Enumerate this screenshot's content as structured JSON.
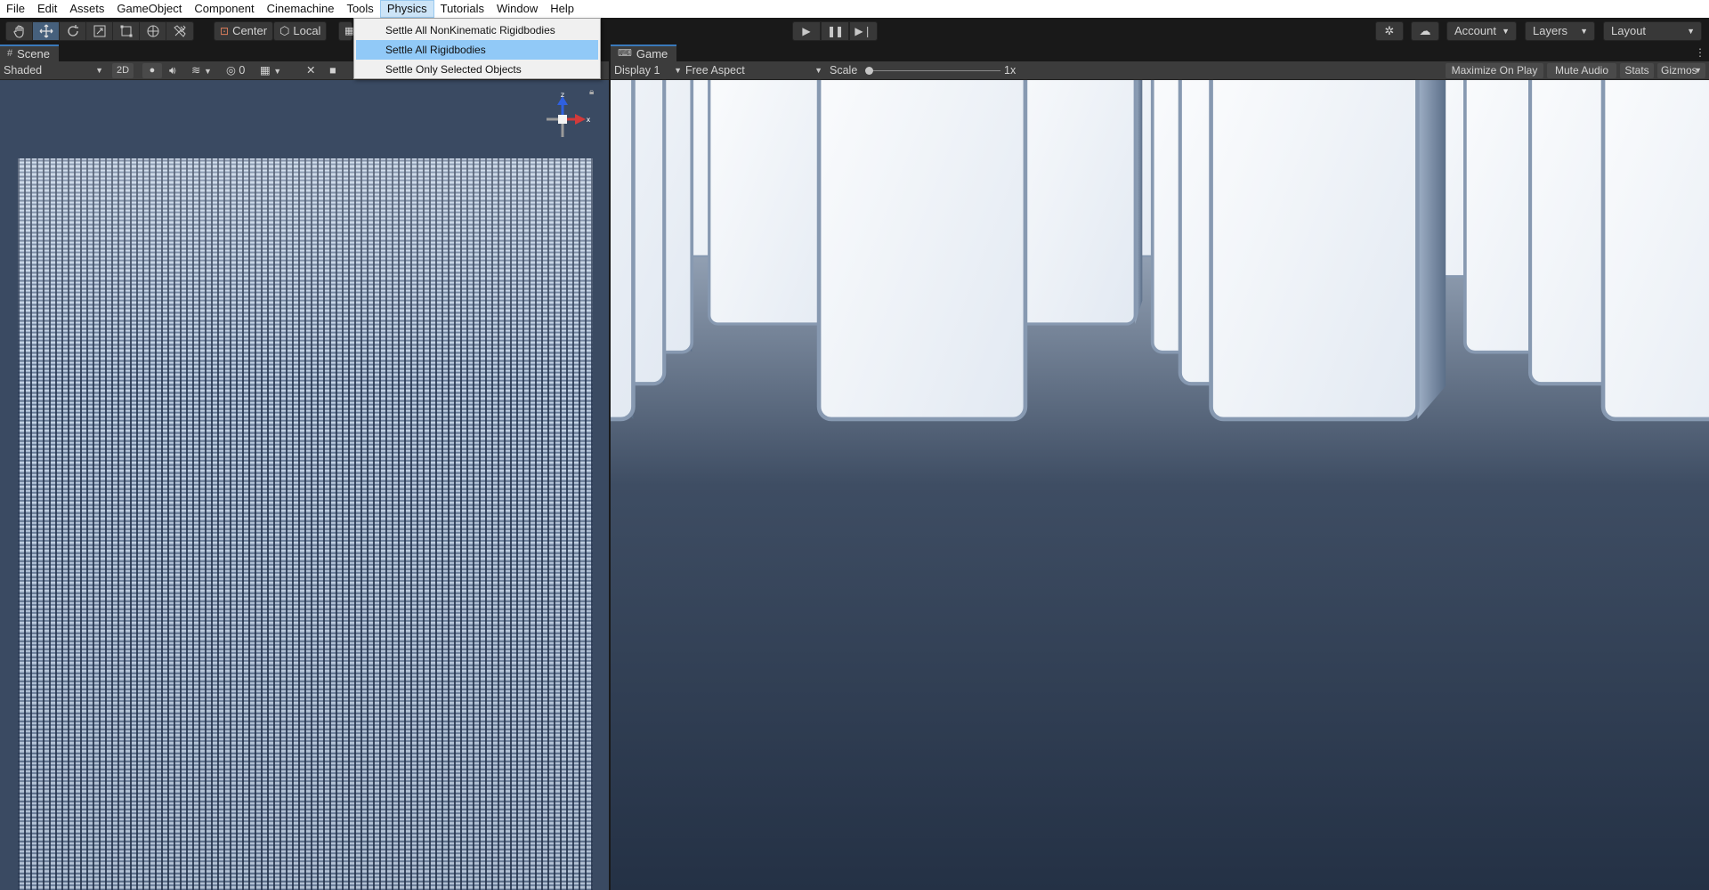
{
  "menubar": {
    "items": [
      "File",
      "Edit",
      "Assets",
      "GameObject",
      "Component",
      "Cinemachine",
      "Tools",
      "Physics",
      "Tutorials",
      "Window",
      "Help"
    ],
    "open_menu": "Physics"
  },
  "physics_menu": {
    "items": [
      "Settle All NonKinematic Rigidbodies",
      "Settle All Rigidbodies",
      "Settle Only Selected Objects"
    ],
    "highlighted": "Settle All Rigidbodies"
  },
  "toolbar": {
    "pivot_label": "Center",
    "space_label": "Local",
    "account_label": "Account",
    "layers_label": "Layers",
    "layout_label": "Layout",
    "tool_icons": [
      "hand-icon",
      "move-icon",
      "rotate-icon",
      "scale-icon",
      "rect-icon",
      "transform-icon",
      "custom-tool-icon"
    ]
  },
  "scene": {
    "tab_label": "Scene",
    "draw_mode": "Shaded",
    "mode_2d_label": "2D",
    "hidden_count": "0",
    "gizmo_axes": {
      "y": "z",
      "x": "x"
    }
  },
  "game": {
    "tab_label": "Game",
    "display": "Display 1",
    "aspect": "Free Aspect",
    "scale_label": "Scale",
    "scale_value": "1x",
    "scale_fraction": 0.0,
    "maximize_label": "Maximize On Play",
    "mute_label": "Mute Audio",
    "stats_label": "Stats",
    "gizmos_label": "Gizmos"
  },
  "colors": {
    "accent": "#3a79bb",
    "menu_highlight": "#91c9f7",
    "domino": "#f1f5fa",
    "floor": "#1f2a3a"
  }
}
